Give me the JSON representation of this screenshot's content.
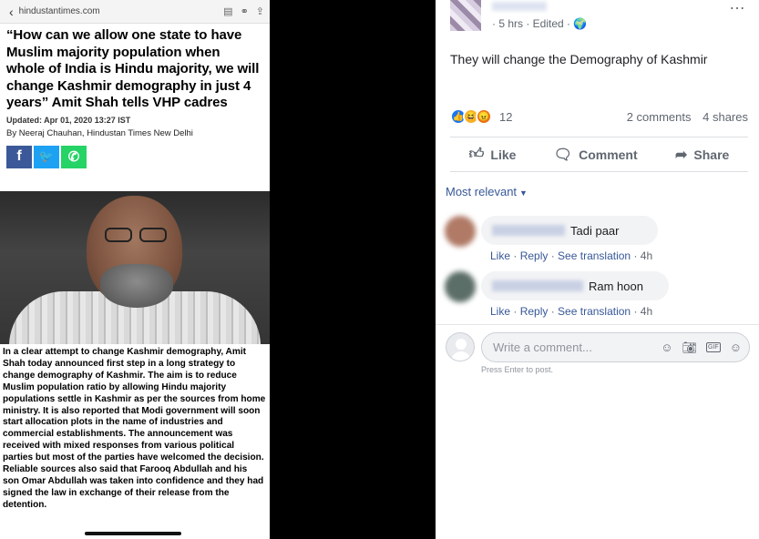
{
  "article": {
    "url": "hindustantimes.com",
    "title": "“How can we allow one state to have Muslim majority population when whole of India is Hindu majority, we will change Kashmir demography in just 4 years” Amit Shah tells VHP cadres",
    "updated": "Updated: Apr 01, 2020 13:27 IST",
    "byline": "By Neeraj Chauhan, Hindustan Times New Delhi",
    "share_icons": [
      "facebook-icon",
      "twitter-icon",
      "whatsapp-icon"
    ],
    "share_glyphs": [
      "f",
      "🐦",
      "✆"
    ],
    "body": "In a clear attempt to change Kashmir demography, Amit Shah today announced first step in a long strategy to change demography of Kashmir. The aim is to reduce Muslim population ratio by allowing Hindu majority populations settle in Kashmir as per the sources from home ministry. It is also reported that Modi government will soon start allocation plots in the name of industries and commercial establishments. The announcement was received with mixed responses from various political parties but most of the parties have welcomed the decision. Reliable sources also said that Farooq Abdullah and his son Omar Abdullah was taken into confidence and they had signed the law in exchange of their release from the detention."
  },
  "post": {
    "meta": "· 5 hrs · Edited · 🌍",
    "more": "…",
    "text": "They will change the Demography of Kashmir",
    "reaction_count": "12",
    "comments_count": "2 comments",
    "shares_count": "4 shares",
    "actions": {
      "like": "Like",
      "comment": "Comment",
      "share": "Share"
    },
    "sort_label": "Most relevant",
    "colors": {
      "like": "#1877f2",
      "link": "#385898",
      "bubble": "#f2f3f5"
    }
  },
  "comments": [
    {
      "text": "Tadi paar",
      "like": "Like",
      "reply": "Reply",
      "translate": "See translation",
      "time": "4h"
    },
    {
      "text": "Ram hoon",
      "like": "Like",
      "reply": "Reply",
      "translate": "See translation",
      "time": "4h"
    }
  ],
  "composer": {
    "placeholder": "Write a comment...",
    "hint": "Press Enter to post."
  }
}
